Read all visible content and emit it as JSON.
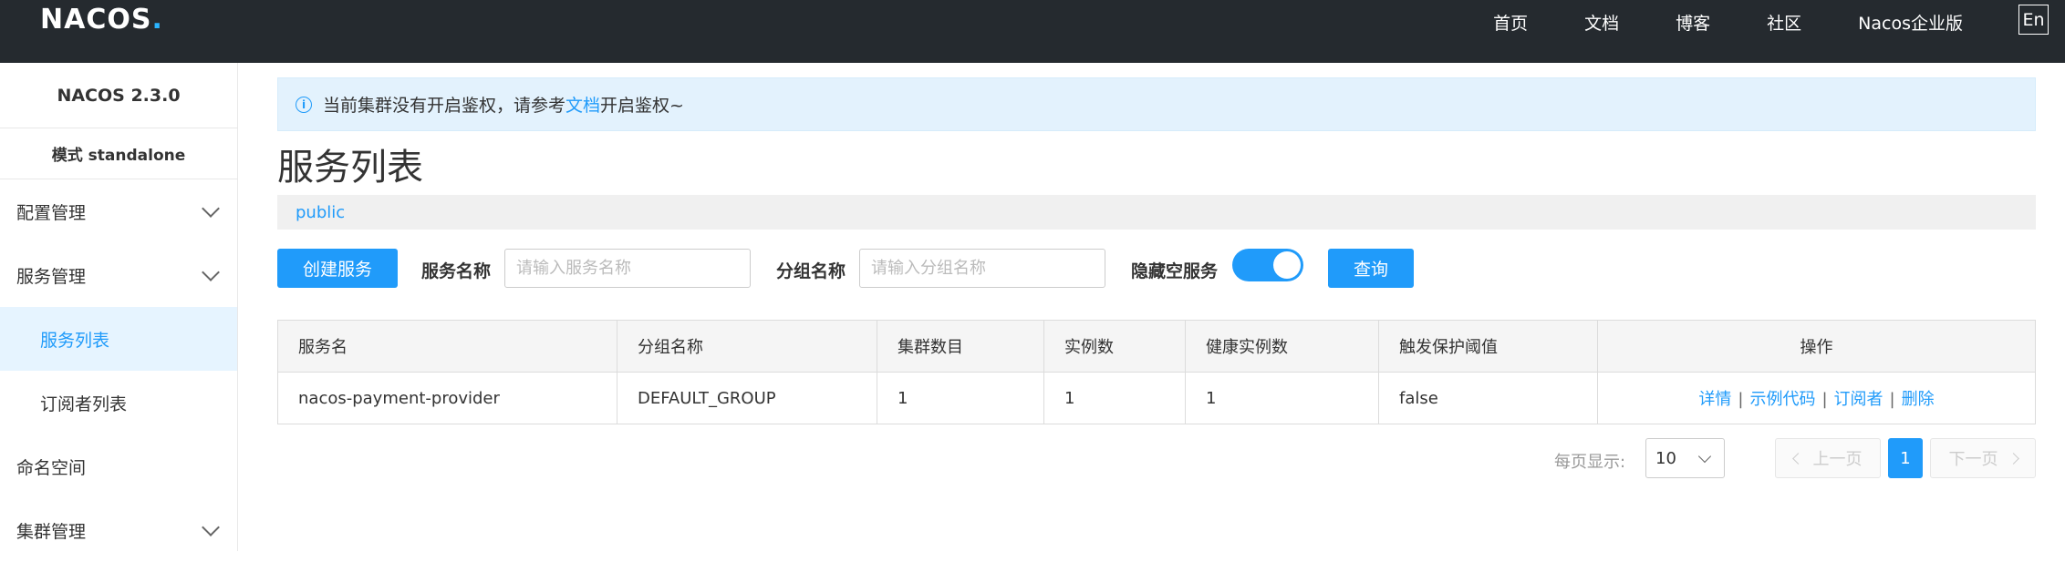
{
  "header": {
    "logo_text": "NACOS",
    "logo_dot": ".",
    "nav": [
      "首页",
      "文档",
      "博客",
      "社区",
      "Nacos企业版"
    ],
    "lang": "En"
  },
  "sidebar": {
    "version": "NACOS 2.3.0",
    "mode": "模式 standalone",
    "items": [
      {
        "label": "配置管理",
        "expandable": true
      },
      {
        "label": "服务管理",
        "expandable": true
      },
      {
        "label": "服务列表",
        "sub": true,
        "active": true
      },
      {
        "label": "订阅者列表",
        "sub": true
      },
      {
        "label": "命名空间",
        "expandable": false
      },
      {
        "label": "集群管理",
        "expandable": true
      }
    ]
  },
  "notice": {
    "icon": "info-icon",
    "text_before": "当前集群没有开启鉴权，请参考",
    "link": "文档",
    "text_after": "开启鉴权~"
  },
  "page_title": "服务列表",
  "namespace": "public",
  "toolbar": {
    "create_label": "创建服务",
    "service_name_label": "服务名称",
    "service_name_placeholder": "请输入服务名称",
    "group_name_label": "分组名称",
    "group_name_placeholder": "请输入分组名称",
    "hide_empty_label": "隐藏空服务",
    "hide_empty_on": true,
    "query_label": "查询"
  },
  "table": {
    "headers": [
      "服务名",
      "分组名称",
      "集群数目",
      "实例数",
      "健康实例数",
      "触发保护阈值",
      "操作"
    ],
    "rows": [
      {
        "service": "nacos-payment-provider",
        "group": "DEFAULT_GROUP",
        "clusters": "1",
        "instances": "1",
        "healthy": "1",
        "threshold": "false",
        "ops": [
          "详情",
          "示例代码",
          "订阅者",
          "删除"
        ]
      }
    ]
  },
  "pagination": {
    "page_size_label": "每页显示:",
    "page_size": "10",
    "prev_label": "上一页",
    "next_label": "下一页",
    "current_page": "1"
  },
  "colors": {
    "accent": "#209bfa",
    "topbar": "#252a2f",
    "notice_bg": "#e3f2fd"
  }
}
